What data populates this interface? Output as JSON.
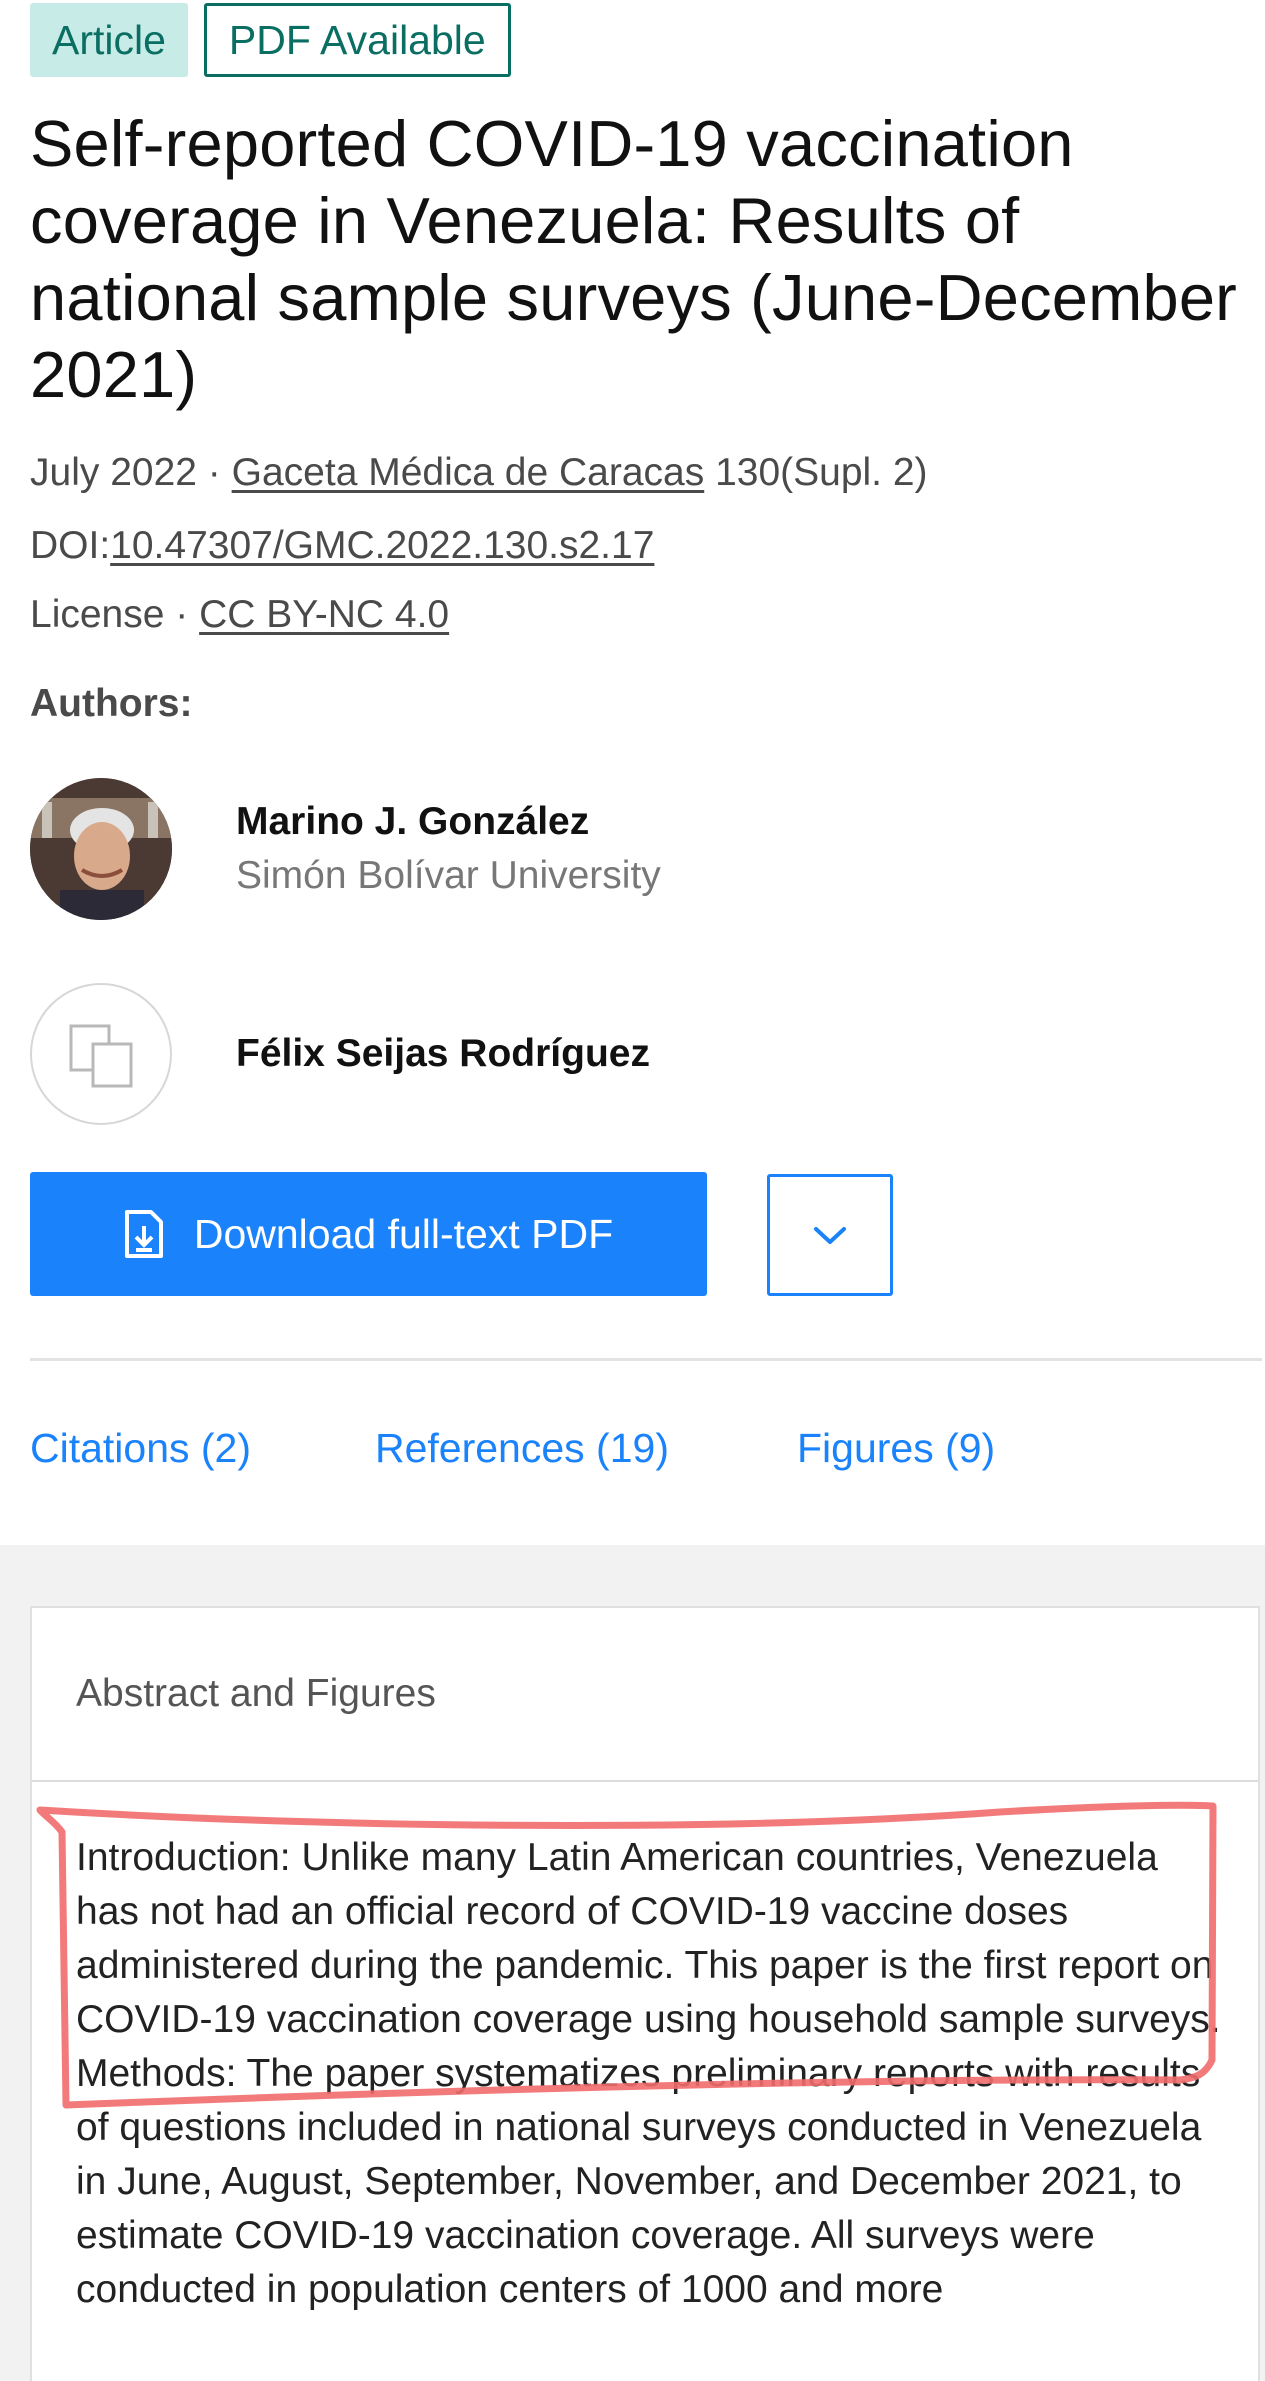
{
  "badges": {
    "article": "Article",
    "pdf_available": "PDF Available"
  },
  "title": "Self-reported COVID-19 vaccination coverage in Venezuela: Results of national sample surveys (June-December 2021)",
  "meta": {
    "date": "July 2022",
    "separator": "·",
    "journal": "Gaceta Médica de Caracas",
    "volume": "130(Supl. 2)",
    "doi_label": "DOI:",
    "doi": "10.47307/GMC.2022.130.s2.17",
    "license_label": "License",
    "license": "CC BY-NC 4.0"
  },
  "authors_heading": "Authors:",
  "authors": [
    {
      "name": "Marino J. González",
      "affiliation": "Simón Bolívar University",
      "avatar": "photo"
    },
    {
      "name": "Félix Seijas Rodríguez",
      "affiliation": "",
      "avatar": "placeholder-icon"
    }
  ],
  "actions": {
    "download_label": "Download full-text PDF",
    "download_icon": "pdf-download-icon",
    "dropdown_icon": "chevron-down-icon"
  },
  "tabs": [
    {
      "label": "Citations (2)"
    },
    {
      "label": "References (19)"
    },
    {
      "label": "Figures (9)"
    }
  ],
  "abstract_card": {
    "header": "Abstract and Figures",
    "text": "Introduction: Unlike many Latin American countries, Venezuela has not had an official record of COVID-19 vaccine doses administered during the pandemic. This paper is the first report on COVID-19 vaccination coverage using household sample surveys. Methods: The paper systematizes preliminary reports with results of questions included in national surveys conducted in Venezuela in June, August, September, November, and December 2021, to estimate COVID-19 vaccination coverage. All surveys were conducted in population centers of 1000 and more"
  },
  "colors": {
    "accent_blue": "#1a82fb",
    "badge_teal": "#0a6e63",
    "badge_bg": "#c7ebe7",
    "highlight_red": "#f26b6b"
  }
}
